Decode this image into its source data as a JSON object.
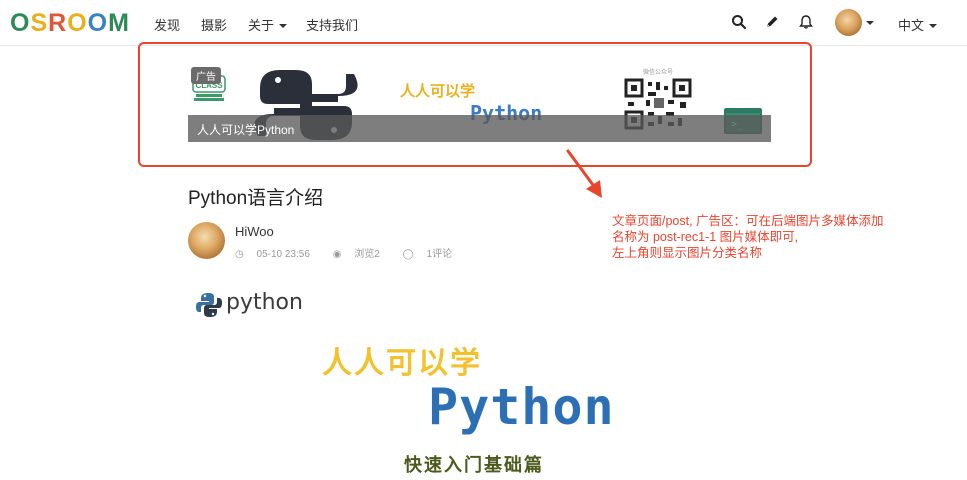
{
  "nav": {
    "logo": [
      "O",
      "S",
      "R",
      "O",
      "O",
      "M"
    ],
    "items": [
      "发现",
      "摄影",
      "关于",
      "支持我们"
    ],
    "language": "中文"
  },
  "ad": {
    "tag": "广告",
    "caption": "人人可以学Python",
    "banner_cn": "人人可以学",
    "banner_py": "Python",
    "qr_label": "微信公众号",
    "class_label": "CLASS",
    "terminal": ">_"
  },
  "post": {
    "title": "Python语言介绍",
    "author": "HiWoo",
    "date": "05-10 23:56",
    "views": "浏览2",
    "comments": "1评论"
  },
  "annotation": {
    "line1": "文章页面/post, 广告区：可在后端图片多媒体添加",
    "line2": "名称为 post-rec1-1 图片媒体即可,",
    "line3": "左上角则显示图片分类名称"
  },
  "content": {
    "python_logo_text": "python",
    "headline_cn": "人人可以学",
    "headline_py": "Python",
    "subtitle": "快速入门基础篇"
  },
  "colors": {
    "annotation_red": "#e8452f",
    "python_blue": "#2c6fb5",
    "python_yellow": "#f2c12e"
  }
}
